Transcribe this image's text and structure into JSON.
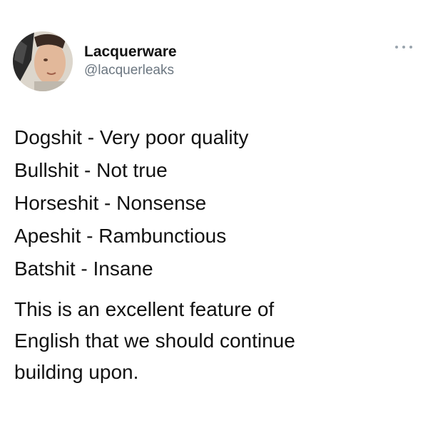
{
  "author": {
    "display_name": "Lacquerware",
    "handle": "@lacquerleaks",
    "avatar_icon": "profile-photo"
  },
  "menu": {
    "icon": "more-options-icon"
  },
  "tweet": {
    "lines": [
      "Dogshit - Very poor quality",
      "Bullshit - Not true",
      "Horseshit - Nonsense",
      "Apeshit - Rambunctious",
      "Batshit - Insane"
    ],
    "paragraph": [
      "This is an excellent feature of",
      "English that we should continue",
      "building upon."
    ]
  }
}
